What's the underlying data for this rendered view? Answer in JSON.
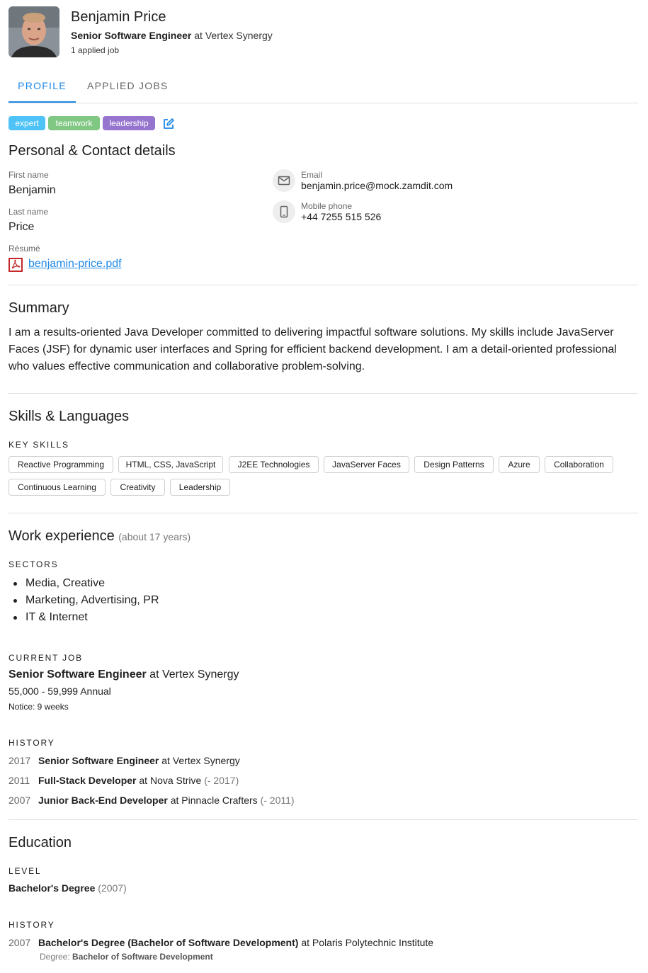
{
  "profile": {
    "name": "Benjamin Price",
    "role_title": "Senior Software Engineer",
    "role_at": "at",
    "role_company": "Vertex Synergy",
    "applied_jobs": "1 applied job"
  },
  "tabs": [
    {
      "label": "PROFILE",
      "active": true
    },
    {
      "label": "APPLIED JOBS",
      "active": false
    }
  ],
  "tags": [
    {
      "label": "expert",
      "color": "#4fc3f7"
    },
    {
      "label": "teamwork",
      "color": "#81c784"
    },
    {
      "label": "leadership",
      "color": "#9575cd"
    }
  ],
  "personal": {
    "heading": "Personal & Contact details",
    "first_name_label": "First name",
    "first_name": "Benjamin",
    "last_name_label": "Last name",
    "last_name": "Price",
    "resume_label": "Résumé",
    "resume_file": "benjamin-price.pdf",
    "email_label": "Email",
    "email": "benjamin.price@mock.zamdit.com",
    "phone_label": "Mobile phone",
    "phone": "+44 7255 515 526"
  },
  "summary": {
    "heading": "Summary",
    "text": "I am a results-oriented Java Developer committed to delivering impactful software solutions. My skills include JavaServer Faces (JSF) for dynamic user interfaces and Spring for efficient backend development. I am a detail-oriented professional who values effective communication and collaborative problem-solving."
  },
  "skills": {
    "heading": "Skills & Languages",
    "key_skills_label": "KEY SKILLS",
    "items": [
      "Reactive Programming",
      "HTML, CSS, JavaScript",
      "J2EE Technologies",
      "JavaServer Faces",
      "Design Patterns",
      "Azure",
      "Collaboration",
      "Continuous Learning",
      "Creativity",
      "Leadership"
    ]
  },
  "work": {
    "heading": "Work experience",
    "duration": "(about 17 years)",
    "sectors_label": "SECTORS",
    "sectors": [
      "Media, Creative",
      "Marketing, Advertising, PR",
      "IT & Internet"
    ],
    "current_label": "CURRENT JOB",
    "current_title": "Senior Software Engineer",
    "current_at": "at Vertex Synergy",
    "salary": "55,000 - 59,999 Annual",
    "notice": "Notice: 9 weeks",
    "history_label": "HISTORY",
    "history": [
      {
        "year": "2017",
        "title": "Senior Software Engineer",
        "company": "at Vertex Synergy",
        "end": ""
      },
      {
        "year": "2011",
        "title": "Full-Stack Developer",
        "company": "at Nova Strive",
        "end": "(- 2017)"
      },
      {
        "year": "2007",
        "title": "Junior Back-End Developer",
        "company": "at Pinnacle Crafters",
        "end": "(- 2011)"
      }
    ]
  },
  "education": {
    "heading": "Education",
    "level_label": "LEVEL",
    "level": "Bachelor's Degree",
    "level_year": "(2007)",
    "history_label": "HISTORY",
    "history_year": "2007",
    "history_title": "Bachelor's Degree (Bachelor of Software Development)",
    "history_institute": "at Polaris Polytechnic Institute",
    "degree_label": "Degree:",
    "degree_value": "Bachelor of Software Development"
  }
}
